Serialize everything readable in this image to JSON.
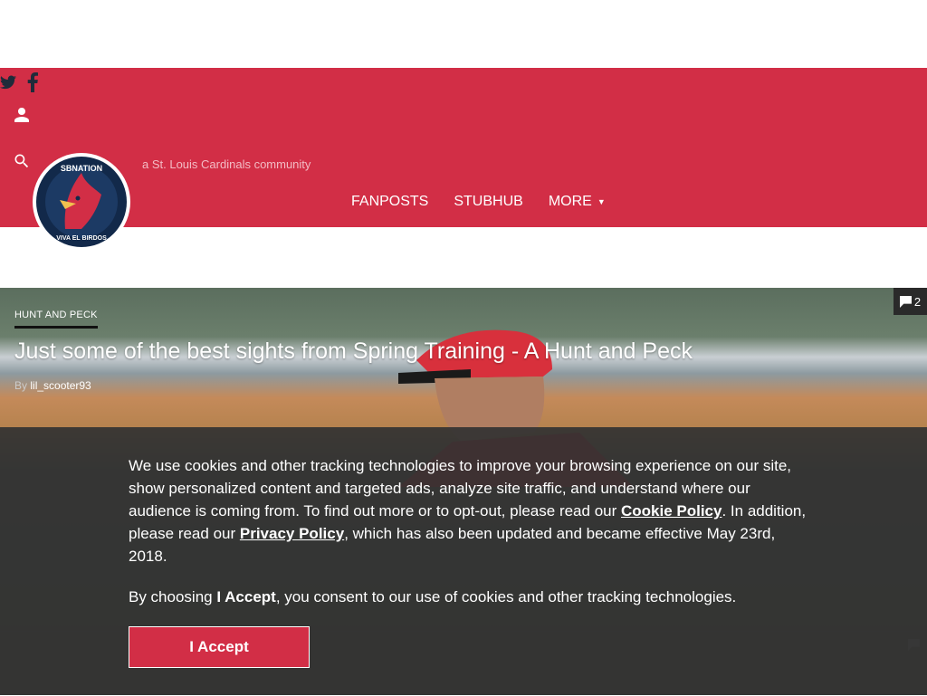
{
  "site": {
    "tagline": "a St. Louis Cardinals community",
    "logo": {
      "top_text": "SBNATION",
      "bottom_text": "VIVA EL BIRDOS"
    },
    "brand_color": "#d22e46"
  },
  "header": {
    "social_icons": [
      "twitter-icon",
      "facebook-icon"
    ],
    "user_icon": "person-icon",
    "search_icon": "search-icon",
    "nav": {
      "fanposts": "FANPOSTS",
      "stubhub": "STUBHUB",
      "more": "MORE",
      "more_caret": "▼"
    }
  },
  "hero": {
    "category": "HUNT AND PECK",
    "title": "Just some of the best sights from Spring Training - A Hunt and Peck",
    "byline_prefix": "By",
    "author": "lil_scooter93",
    "comment_count": "2"
  },
  "cookie_banner": {
    "text_1": "We use cookies and other tracking technologies to improve your browsing experience on our site, show personalized content and targeted ads, analyze site traffic, and understand where our audience is coming from. To find out more or to opt-out, please read our ",
    "cookie_policy_link": "Cookie Policy",
    "text_2": ". In addition, please read our ",
    "privacy_policy_link": "Privacy Policy",
    "text_3": ", which has also been updated and became effective May 23rd, 2018.",
    "consent_prefix": "By choosing ",
    "consent_bold": "I Accept",
    "consent_suffix": ", you consent to our use of cookies and other tracking technologies.",
    "accept_label": "I Accept"
  }
}
